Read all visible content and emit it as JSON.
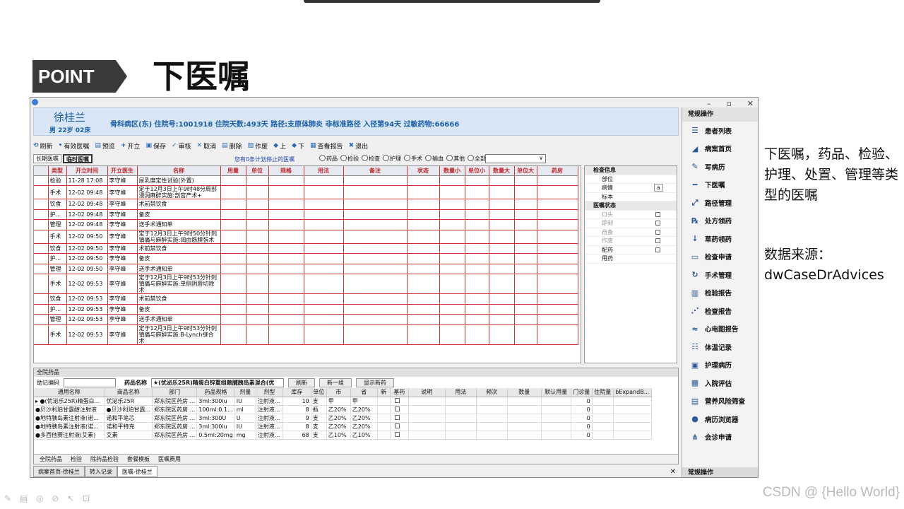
{
  "slide": {
    "point_label": "POINT",
    "title": "下医嘱",
    "description": "下医嘱，药品、检验、护理、处置、管理等类型的医嘱",
    "source_label": "数据来源：",
    "source_value": "dwCaseDrAdvices",
    "watermark": "CSDN @ {Hello World}",
    "pen_tools": "✎ ▤ ◎ ⊘ ↖ ⊡"
  },
  "window": {
    "controls": [
      "–",
      "▫",
      "✕"
    ]
  },
  "patient": {
    "name": "徐桂兰",
    "info": "男 22岁 02床",
    "line": "骨科病区(东) 住院号:1001918 住院天数:493天  路径:支原体肺炎 非标准路径 入径第94天 过敏药物:66666"
  },
  "toolbar": [
    {
      "icon": "⟲",
      "label": "刷新"
    },
    {
      "icon": "•",
      "label": "有效医嘱"
    },
    {
      "icon": "▤",
      "label": "预览"
    },
    {
      "icon": "+",
      "label": "开立"
    },
    {
      "icon": "▣",
      "label": "保存"
    },
    {
      "icon": "✓",
      "label": "审核"
    },
    {
      "icon": "✕",
      "label": "取消"
    },
    {
      "icon": "▤",
      "label": "删除"
    },
    {
      "icon": "▧",
      "label": "作废"
    },
    {
      "icon": "◆",
      "label": "上"
    },
    {
      "icon": "◆",
      "label": "下"
    },
    {
      "icon": "▦",
      "label": "查看报告"
    },
    {
      "icon": "✖",
      "label": "退出"
    }
  ],
  "filters": {
    "long_tab": "长期医嘱",
    "temp_tab": "临时医嘱",
    "notice": "您有0条计划停止的医嘱",
    "radios": [
      "药品",
      "检验",
      "检查",
      "护理",
      "手术",
      "输血",
      "其他",
      "全部"
    ],
    "combo": "∨"
  },
  "orders": {
    "columns": [
      "类型",
      "开立时间",
      "开立医生",
      "名称",
      "用量",
      "单位",
      "规格",
      "用法",
      "备注",
      "状态",
      "数量小",
      "单位小",
      "数量大",
      "单位大",
      "药房"
    ],
    "rows": [
      {
        "type": "检验",
        "time": "11-28 17:08",
        "doctor": "李守峰",
        "name": "尿乳糜定性试验(外置)"
      },
      {
        "type": "手术",
        "time": "12-02 09:48",
        "doctor": "李守峰",
        "name": "定于12月3日上午9时48分局部浸润麻醉实施:剖宫产术+"
      },
      {
        "type": "饮食",
        "time": "12-02 09:48",
        "doctor": "李守峰",
        "name": "术前禁饮食"
      },
      {
        "type": "护...",
        "time": "12-02 09:48",
        "doctor": "李守峰",
        "name": "备皮"
      },
      {
        "type": "管理",
        "time": "12-02 09:48",
        "doctor": "李守峰",
        "name": "送手术通知单"
      },
      {
        "type": "手术",
        "time": "12-02 09:50",
        "doctor": "李守峰",
        "name": "定于12月3日上午9时50分针刺镇痛与麻醉实施:阔由筋膜張术"
      },
      {
        "type": "饮食",
        "time": "12-02 09:50",
        "doctor": "李守峰",
        "name": "术前禁饮食"
      },
      {
        "type": "护...",
        "time": "12-02 09:50",
        "doctor": "李守峰",
        "name": "备皮"
      },
      {
        "type": "管理",
        "time": "12-02 09:50",
        "doctor": "李守峰",
        "name": "送手术通知单"
      },
      {
        "type": "手术",
        "time": "12-02 09:53",
        "doctor": "李守峰",
        "name": "定于12月3日上午9时53分针刺镇痛与麻醉实施:单侧阴唇切除术"
      },
      {
        "type": "饮食",
        "time": "12-02 09:53",
        "doctor": "李守峰",
        "name": "术前禁饮食"
      },
      {
        "type": "护...",
        "time": "12-02 09:53",
        "doctor": "李守峰",
        "name": "备皮"
      },
      {
        "type": "管理",
        "time": "12-02 09:53",
        "doctor": "李守峰",
        "name": "送手术通知单"
      },
      {
        "type": "手术",
        "time": "12-02 09:53",
        "doctor": "李守峰",
        "name": "定于12月3日上午9时53分针刺镇痛与麻醉实施:B-Lynch缝合术"
      }
    ]
  },
  "side": {
    "rows": [
      {
        "kind": "head",
        "label": "检查信息"
      },
      {
        "kind": "field",
        "label": "部位"
      },
      {
        "kind": "field",
        "label": "病情",
        "extra": "a"
      },
      {
        "kind": "field",
        "label": "标本"
      },
      {
        "kind": "head",
        "label": "医嘱状态"
      },
      {
        "kind": "check",
        "label": "口头",
        "dim": true
      },
      {
        "kind": "check",
        "label": "即刻",
        "dim": true
      },
      {
        "kind": "check",
        "label": "自备",
        "dim": true
      },
      {
        "kind": "check",
        "label": "作废",
        "dim": true
      },
      {
        "kind": "check",
        "label": "配药",
        "dim": false
      },
      {
        "kind": "field",
        "label": "用药"
      }
    ]
  },
  "hospital": {
    "header": "全院药品",
    "search_label": "助记编码",
    "drug_label": "药品名称",
    "drug_value": "★(优泌乐25R)精蛋白锌重组赖脯胰岛素混合(优",
    "btn_refresh": "刷新",
    "btn_newgroup": "新一组",
    "btn_show": "显示新药",
    "columns": [
      "通用名称",
      "商品名称",
      "部门",
      "药品规格",
      "剂量",
      "剂型",
      "库存",
      "单位",
      "市",
      "省",
      "新",
      "基药",
      "说明",
      "用法",
      "频次",
      "数量",
      "默认用量",
      "门诊量",
      "住院量",
      "bExpandB..."
    ],
    "rows": [
      [
        "▸ ●(优泌乐25R)精蛋白...",
        "优泌乐25R",
        "郑东院区药房 ...",
        "3ml:300iu",
        "IU",
        "注射液...",
        "10",
        "支",
        "甲",
        "甲",
        "",
        "",
        "",
        "",
        "",
        "",
        "",
        "0",
        "",
        ""
      ],
      [
        "●贝沙利珀甘露醇注射液",
        "●贝沙利珀甘露...",
        "郑东院区药房 ...",
        "100ml:0.1...",
        "ml",
        "注射液...",
        "8",
        "瓶",
        "乙20%",
        "乙20%",
        "",
        "",
        "",
        "",
        "",
        "",
        "",
        "0",
        "",
        ""
      ],
      [
        "●地特胰岛素注射液(诺...",
        "诺和平笔芯",
        "郑东院区药房 ...",
        "3ml:300U",
        "U",
        "注射液...",
        "9",
        "支",
        "乙20%",
        "乙20%",
        "",
        "",
        "",
        "",
        "",
        "",
        "",
        "0",
        "",
        ""
      ],
      [
        "●地特胰岛素注射液(诺...",
        "诺和平特充",
        "郑东院区药房 ...",
        "3ml:300iu",
        "IU",
        "注射液...",
        "8",
        "支",
        "乙20%",
        "乙20%",
        "",
        "",
        "",
        "",
        "",
        "",
        "",
        "0",
        "",
        ""
      ],
      [
        "●多西他赛注射液(艾素)",
        "艾素",
        "郑东院区药房 ...",
        "0.5ml:20mg",
        "mg",
        "注射液...",
        "68",
        "支",
        "乙10%",
        "乙10%",
        "",
        "",
        "",
        "",
        "",
        "",
        "",
        "0",
        "",
        ""
      ]
    ],
    "tabs": [
      "全院药品",
      "检验",
      "除药品检验",
      "套餐模板",
      "医嘱费用"
    ]
  },
  "bottom_tabs": [
    "病案首页-徐桂兰",
    "转入记录",
    "医嘱-徐桂兰"
  ],
  "close_tab": "✕",
  "panel": {
    "header": "常规操作",
    "footer": "常规操作",
    "items": [
      {
        "icon": "☰",
        "label": "患者列表"
      },
      {
        "icon": "◢",
        "label": "病案首页"
      },
      {
        "icon": "✎",
        "label": "写病历"
      },
      {
        "icon": "━",
        "label": "下医嘱"
      },
      {
        "icon": "⤢",
        "label": "路径管理"
      },
      {
        "icon": "℞",
        "label": "处方领药"
      },
      {
        "icon": "↓",
        "label": "草药领药"
      },
      {
        "icon": "▭",
        "label": "检查申请"
      },
      {
        "icon": "↻",
        "label": "手术管理"
      },
      {
        "icon": "▥",
        "label": "检验报告"
      },
      {
        "icon": "⋰",
        "label": "检查报告"
      },
      {
        "icon": "≈",
        "label": "心电图报告"
      },
      {
        "icon": "☷",
        "label": "体温记录"
      },
      {
        "icon": "▣",
        "label": "护理病历"
      },
      {
        "icon": "▦",
        "label": "入院评估"
      },
      {
        "icon": "▤",
        "label": "营养风险筛查"
      },
      {
        "icon": "●",
        "label": "病历浏览器"
      },
      {
        "icon": "⋔",
        "label": "会诊申请"
      }
    ]
  }
}
